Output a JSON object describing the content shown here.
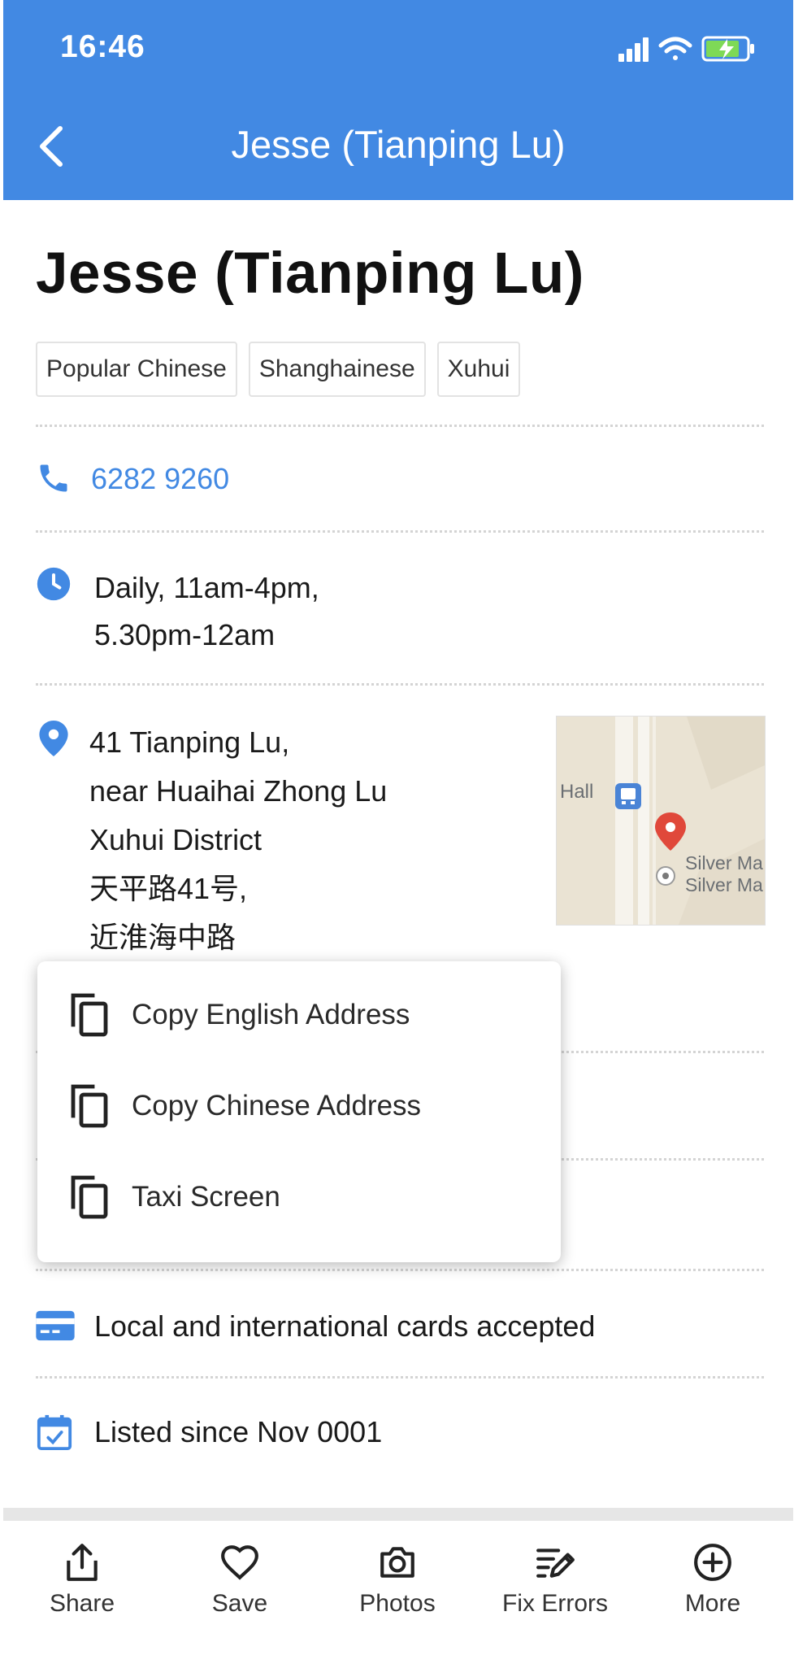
{
  "status_bar": {
    "time": "16:46"
  },
  "nav": {
    "title": "Jesse (Tianping Lu)"
  },
  "listing": {
    "title": "Jesse (Tianping Lu)",
    "tags": [
      "Popular Chinese",
      "Shanghainese",
      "Xuhui"
    ],
    "phone": "6282 9260",
    "hours": [
      "Daily, 11am-4pm,",
      "5.30pm-12am"
    ],
    "address": [
      "41 Tianping Lu,",
      "near Huaihai Zhong Lu",
      "Xuhui District",
      "天平路41号,",
      "近淮海中路"
    ],
    "payment": "Local and international cards accepted",
    "listed_since": "Listed since Nov 0001"
  },
  "map": {
    "labels": [
      "Hall",
      "Silver Ma",
      "Silver Ma"
    ]
  },
  "popup_menu": {
    "items": [
      "Copy English Address",
      "Copy Chinese Address",
      "Taxi Screen"
    ]
  },
  "bottom_bar": {
    "items": [
      {
        "label": "Share",
        "icon": "share-icon"
      },
      {
        "label": "Save",
        "icon": "heart-icon"
      },
      {
        "label": "Photos",
        "icon": "camera-icon"
      },
      {
        "label": "Fix Errors",
        "icon": "edit-list-icon"
      },
      {
        "label": "More",
        "icon": "plus-circle-icon"
      }
    ]
  },
  "colors": {
    "accent": "#4289e3",
    "pin": "#e0483a"
  }
}
